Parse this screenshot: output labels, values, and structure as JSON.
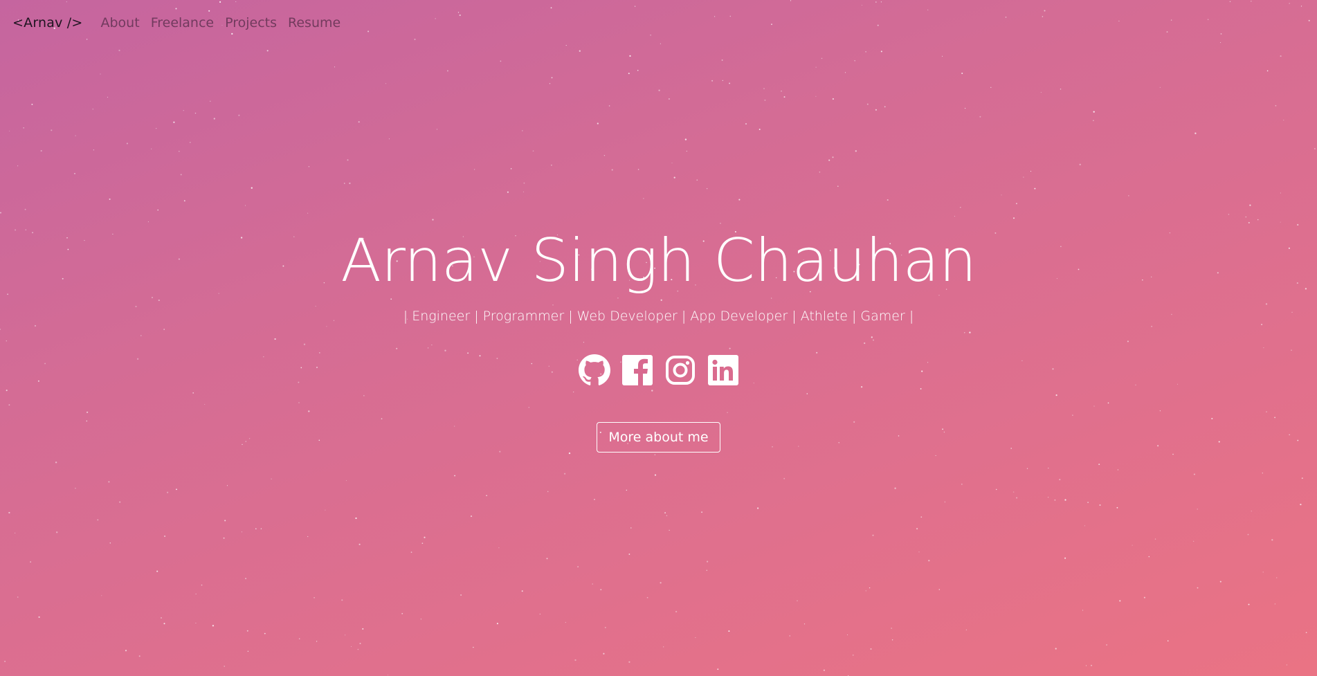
{
  "theme": {
    "gradient_start": "#c5659f",
    "gradient_end": "#ea7384",
    "text_color": "#ffffff"
  },
  "nav": {
    "brand": "<Arnav />",
    "links": [
      "About",
      "Freelance",
      "Projects",
      "Resume"
    ]
  },
  "hero": {
    "name": "Arnav Singh Chauhan",
    "tagline": "| Engineer | Programmer | Web Developer | App Developer | Athlete | Gamer |",
    "socials": [
      {
        "icon": "github-icon"
      },
      {
        "icon": "facebook-icon"
      },
      {
        "icon": "instagram-icon"
      },
      {
        "icon": "linkedin-icon"
      }
    ],
    "cta_label": "More about me"
  }
}
